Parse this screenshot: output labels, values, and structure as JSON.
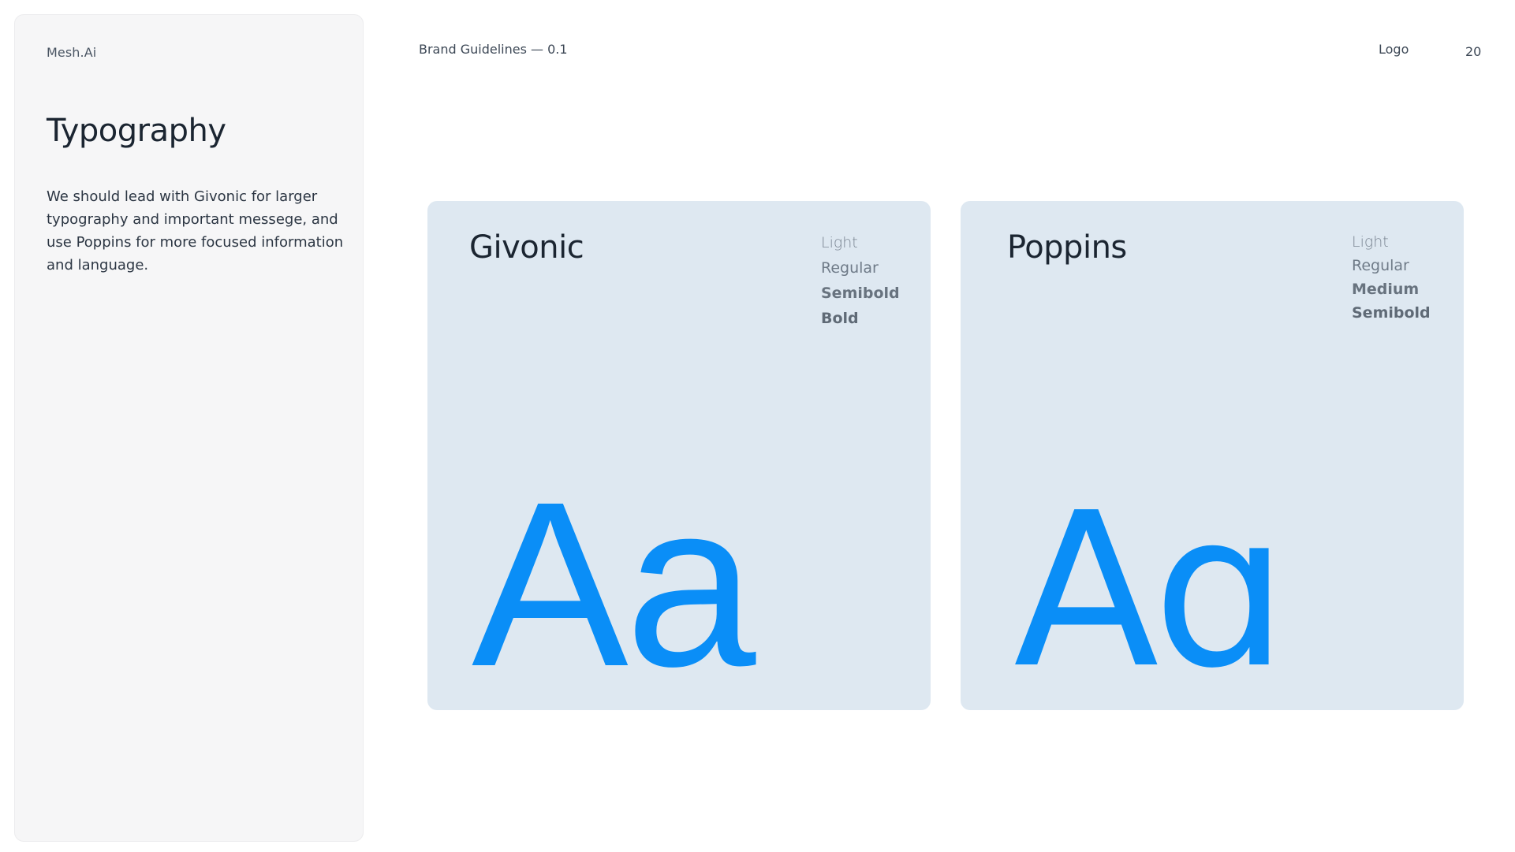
{
  "brand": "Mesh.Ai",
  "section": {
    "title": "Typography",
    "description": "We should lead with Givonic for larger typography and important messege, and use Poppins for more focused information and language."
  },
  "header": {
    "doc_title": "Brand Guidelines — 0.1",
    "nav_label": "Logo",
    "page_number": "20"
  },
  "fonts": [
    {
      "name": "Givonic",
      "weights": [
        "Light",
        "Regular",
        "Semibold",
        "Bold"
      ],
      "specimen": "Aa"
    },
    {
      "name": "Poppins",
      "weights": [
        "Light",
        "Regular",
        "Medium",
        "Semibold"
      ],
      "specimen": "Aɑ"
    }
  ],
  "colors": {
    "accent": "#0A8EF7",
    "card_background": "#DEE8F1",
    "sidebar_background": "#F6F6F7",
    "heading": "#1B2531",
    "muted": "#6B7785"
  }
}
